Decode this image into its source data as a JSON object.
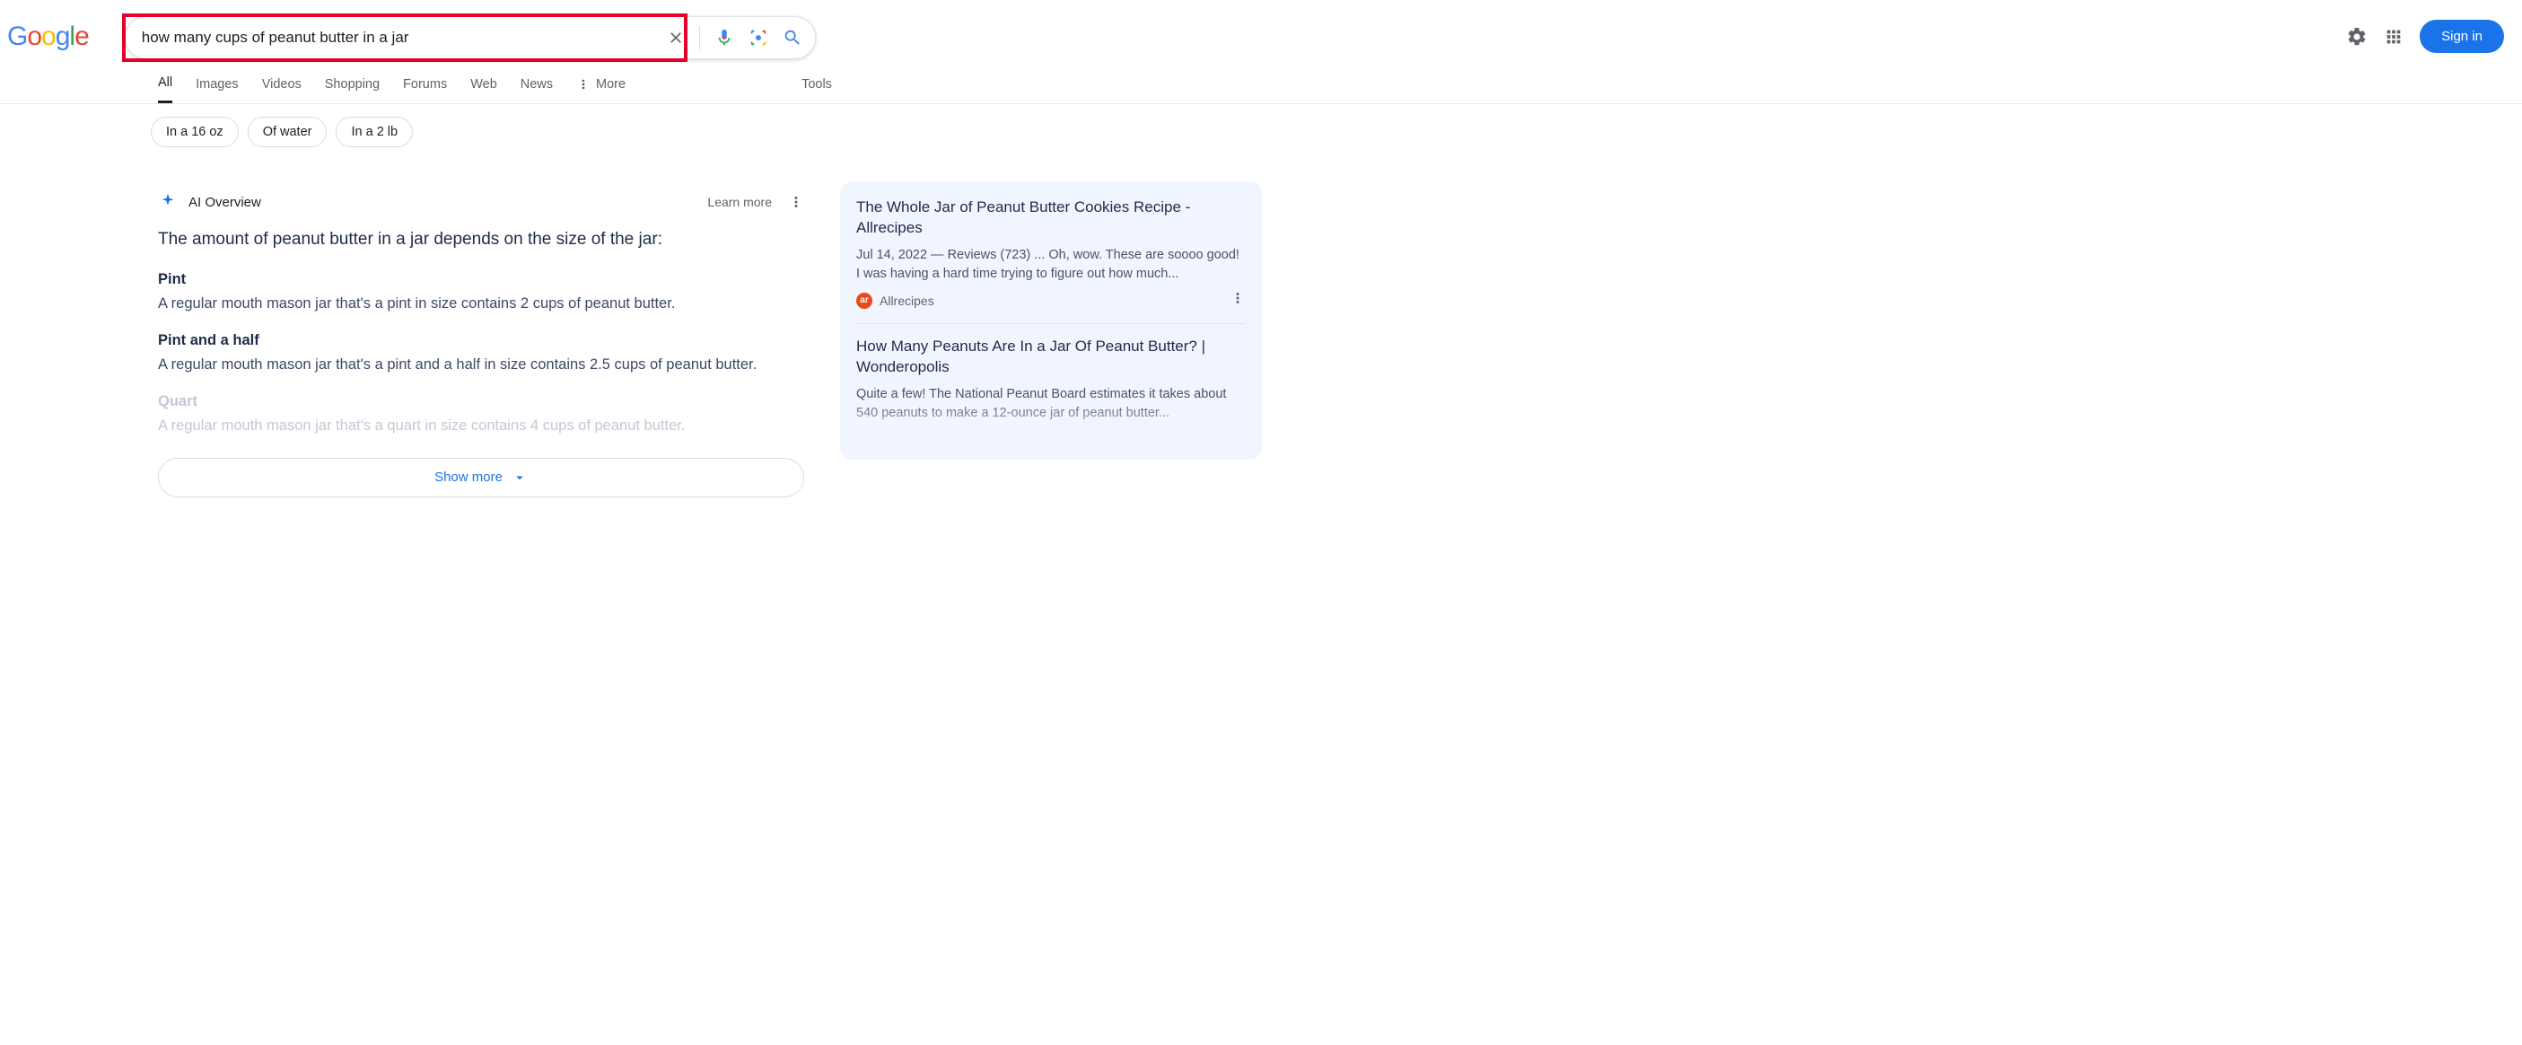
{
  "search": {
    "query": "how many cups of peanut butter in a jar"
  },
  "header": {
    "signin": "Sign in"
  },
  "tabs": {
    "items": [
      "All",
      "Images",
      "Videos",
      "Shopping",
      "Forums",
      "Web",
      "News"
    ],
    "more": "More",
    "tools": "Tools"
  },
  "chips": [
    "In a 16 oz",
    "Of water",
    "In a 2 lb"
  ],
  "ai": {
    "label": "AI Overview",
    "learn_more": "Learn more",
    "summary": "The amount of peanut butter in a jar depends on the size of the jar:",
    "sections": [
      {
        "title": "Pint",
        "body": "A regular mouth mason jar that's a pint in size contains 2 cups of peanut butter."
      },
      {
        "title": "Pint and a half",
        "body": "A regular mouth mason jar that's a pint and a half in size contains 2.5 cups of peanut butter."
      },
      {
        "title": "Quart",
        "body": "A regular mouth mason jar that's a quart in size contains 4 cups of peanut butter."
      }
    ],
    "show_more": "Show more"
  },
  "side": [
    {
      "title": "The Whole Jar of Peanut Butter Cookies Recipe - Allrecipes",
      "snippet": "Jul 14, 2022 — Reviews (723) ... Oh, wow. These are soooo good! I was having a hard time trying to figure out how much...",
      "source": "Allrecipes",
      "badge": "ar"
    },
    {
      "title": "How Many Peanuts Are In a Jar Of Peanut Butter? | Wonderopolis",
      "snippet": "Quite a few! The National Peanut Board estimates it takes about 540 peanuts to make a 12-ounce jar of peanut butter...",
      "source": "",
      "badge": ""
    }
  ]
}
